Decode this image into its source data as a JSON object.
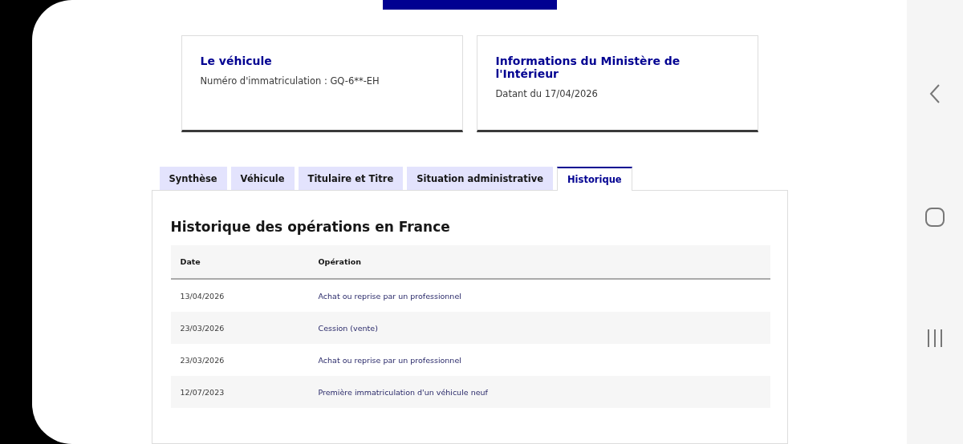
{
  "cards": [
    {
      "title": "Le véhicule",
      "text": "Numéro d'immatriculation : GQ-6**-EH"
    },
    {
      "title": "Informations du Ministère de l'Intérieur",
      "text": "Datant du 17/04/2026"
    }
  ],
  "tabs": [
    {
      "label": "Synthèse",
      "selected": false
    },
    {
      "label": "Véhicule",
      "selected": false
    },
    {
      "label": "Titulaire et Titre",
      "selected": false
    },
    {
      "label": "Situation administrative",
      "selected": false
    },
    {
      "label": "Historique",
      "selected": true
    }
  ],
  "panel": {
    "title": "Historique des opérations en France",
    "table": {
      "columns": [
        "Date",
        "Opération"
      ],
      "rows": [
        [
          "13/04/2026",
          "Achat ou reprise par un professionnel"
        ],
        [
          "23/03/2026",
          "Cession (vente)"
        ],
        [
          "23/03/2026",
          "Achat ou reprise par un professionnel"
        ],
        [
          "12/07/2023",
          "Première immatriculation d'un véhicule neuf"
        ]
      ]
    }
  }
}
